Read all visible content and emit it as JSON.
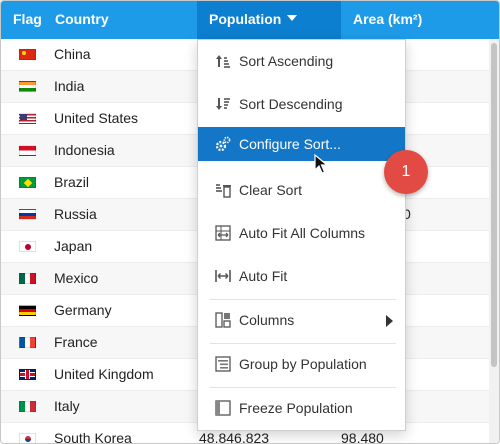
{
  "columns": {
    "flag": "Flag",
    "country": "Country",
    "population": "Population",
    "area": "Area (km²)"
  },
  "rows": [
    {
      "flag_icon": "china-flag-icon",
      "country": "China",
      "population": "",
      "area": ""
    },
    {
      "flag_icon": "india-flag-icon",
      "country": "India",
      "population": "",
      "area": ""
    },
    {
      "flag_icon": "united-states-flag-icon",
      "country": "United States",
      "population": "",
      "area": ""
    },
    {
      "flag_icon": "indonesia-flag-icon",
      "country": "Indonesia",
      "population": "",
      "area": ""
    },
    {
      "flag_icon": "brazil-flag-icon",
      "country": "Brazil",
      "population": "",
      "area": ""
    },
    {
      "flag_icon": "russia-flag-icon",
      "country": "Russia",
      "population": "",
      "area": ""
    },
    {
      "flag_icon": "japan-flag-icon",
      "country": "Japan",
      "population": "",
      "area": ""
    },
    {
      "flag_icon": "mexico-flag-icon",
      "country": "Mexico",
      "population": "",
      "area": ""
    },
    {
      "flag_icon": "germany-flag-icon",
      "country": "Germany",
      "population": "",
      "area": ""
    },
    {
      "flag_icon": "france-flag-icon",
      "country": "France",
      "population": "",
      "area": ""
    },
    {
      "flag_icon": "united-kingdom-flag-icon",
      "country": "United Kingdom",
      "population": "",
      "area": ""
    },
    {
      "flag_icon": "italy-flag-icon",
      "country": "Italy",
      "population": "",
      "area": ""
    },
    {
      "flag_icon": "south-korea-flag-icon",
      "country": "South Korea",
      "population": "48,846,823",
      "area": "98,480"
    }
  ],
  "partial_visible": {
    "russia_area_tail": "0"
  },
  "context_menu": {
    "items": [
      {
        "label": "Sort Ascending",
        "icon": "sort-ascending-icon"
      },
      {
        "label": "Sort Descending",
        "icon": "sort-descending-icon"
      },
      {
        "label": "Configure Sort...",
        "icon": "gears-icon"
      },
      {
        "label": "Clear Sort",
        "icon": "clear-sort-icon"
      },
      {
        "label": "Auto Fit All Columns",
        "icon": "auto-fit-all-icon"
      },
      {
        "label": "Auto Fit",
        "icon": "auto-fit-icon"
      },
      {
        "label": "Columns",
        "icon": "columns-icon"
      },
      {
        "label": "Group by Population",
        "icon": "group-icon"
      },
      {
        "label": "Freeze Population",
        "icon": "freeze-icon"
      }
    ],
    "active_index": 2
  },
  "callout": {
    "number": "1"
  },
  "colors": {
    "header": "#1e9be8",
    "header_active": "#0d7fd0",
    "menu_active": "#1476c6",
    "badge": "#e24b43"
  }
}
